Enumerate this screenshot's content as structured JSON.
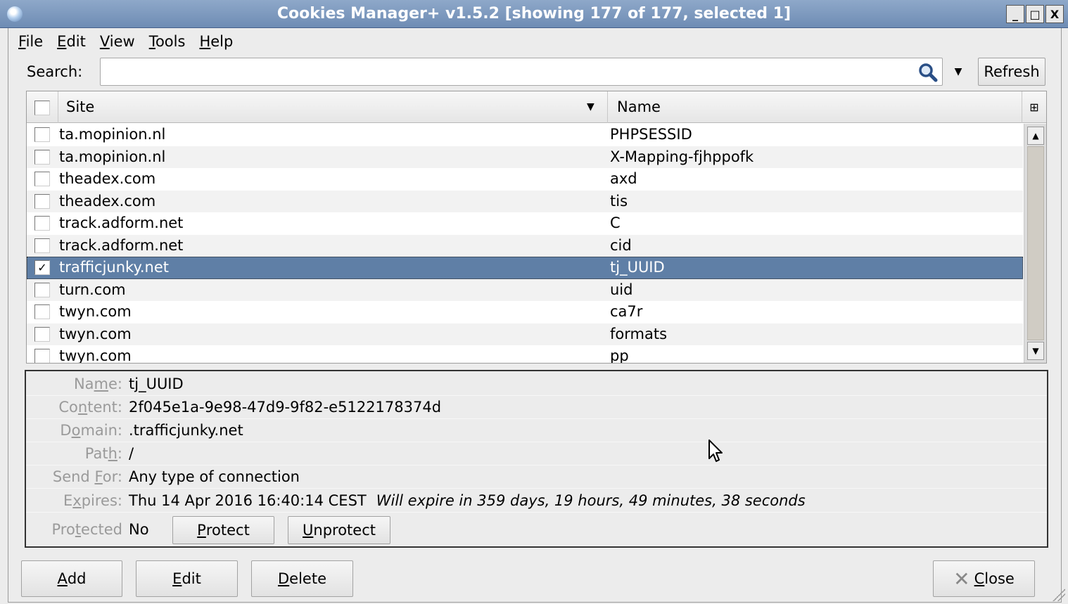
{
  "window": {
    "title": "Cookies Manager+ v1.5.2 [showing 177 of 177, selected 1]",
    "buttons": [
      "_",
      "□",
      "X"
    ]
  },
  "menu": [
    {
      "accel": "F",
      "rest": "ile"
    },
    {
      "accel": "E",
      "rest": "dit"
    },
    {
      "accel": "V",
      "rest": "iew"
    },
    {
      "accel": "T",
      "rest": "ools"
    },
    {
      "accel": "H",
      "rest": "elp"
    }
  ],
  "search": {
    "label": "Search:",
    "value": "",
    "placeholder": "",
    "icon": "magnifier-icon",
    "refresh_label": "Refresh"
  },
  "table": {
    "columns": {
      "site": "Site",
      "name": "Name"
    },
    "sort_indicator": "▼",
    "rows": [
      {
        "site": "ta.mopinion.nl",
        "name": "PHPSESSID",
        "checked": false
      },
      {
        "site": "ta.mopinion.nl",
        "name": "X-Mapping-fjhppofk",
        "checked": false
      },
      {
        "site": "theadex.com",
        "name": "axd",
        "checked": false
      },
      {
        "site": "theadex.com",
        "name": "tis",
        "checked": false
      },
      {
        "site": "track.adform.net",
        "name": "C",
        "checked": false
      },
      {
        "site": "track.adform.net",
        "name": "cid",
        "checked": false
      },
      {
        "site": "trafficjunky.net",
        "name": "tj_UUID",
        "checked": true,
        "selected": true
      },
      {
        "site": "turn.com",
        "name": "uid",
        "checked": false
      },
      {
        "site": "twyn.com",
        "name": "ca7r",
        "checked": false
      },
      {
        "site": "twyn.com",
        "name": "formats",
        "checked": false
      },
      {
        "site": "twyn.com",
        "name": "pp",
        "checked": false
      }
    ]
  },
  "details": {
    "name": {
      "label_pre": "Na",
      "label_accel": "m",
      "label_post": "e:",
      "value": "tj_UUID"
    },
    "content": {
      "label_pre": "Co",
      "label_accel": "n",
      "label_post": "tent:",
      "value": "2f045e1a-9e98-47d9-9f82-e5122178374d"
    },
    "domain": {
      "label_pre": "D",
      "label_accel": "o",
      "label_post": "main:",
      "value": ".trafficjunky.net"
    },
    "path": {
      "label_pre": "Pat",
      "label_accel": "h",
      "label_post": ":",
      "value": "/"
    },
    "send_for": {
      "label_pre": "Send ",
      "label_accel": "F",
      "label_post": "or:",
      "value": "Any type of connection"
    },
    "expires": {
      "label_pre": "E",
      "label_accel": "x",
      "label_post": "pires:",
      "value": "Thu 14 Apr 2016 16:40:14 CEST",
      "note": "Will expire in 359 days, 19 hours, 49 minutes, 38 seconds"
    },
    "protected": {
      "label_pre": "Pro",
      "label_accel": "t",
      "label_post": "ected",
      "value": "No"
    },
    "protect_button": {
      "accel": "P",
      "rest": "rotect"
    },
    "unprotect_button": {
      "accel": "U",
      "rest": "nprotect"
    }
  },
  "footer": {
    "add": {
      "accel": "A",
      "rest": "dd"
    },
    "edit": {
      "accel": "E",
      "rest": "dit"
    },
    "delete": {
      "accel": "D",
      "rest": "elete"
    },
    "close": {
      "accel": "C",
      "rest": "lose"
    }
  },
  "colors": {
    "selection": "#5f7fa6",
    "titlebar": "#7a96bd"
  }
}
